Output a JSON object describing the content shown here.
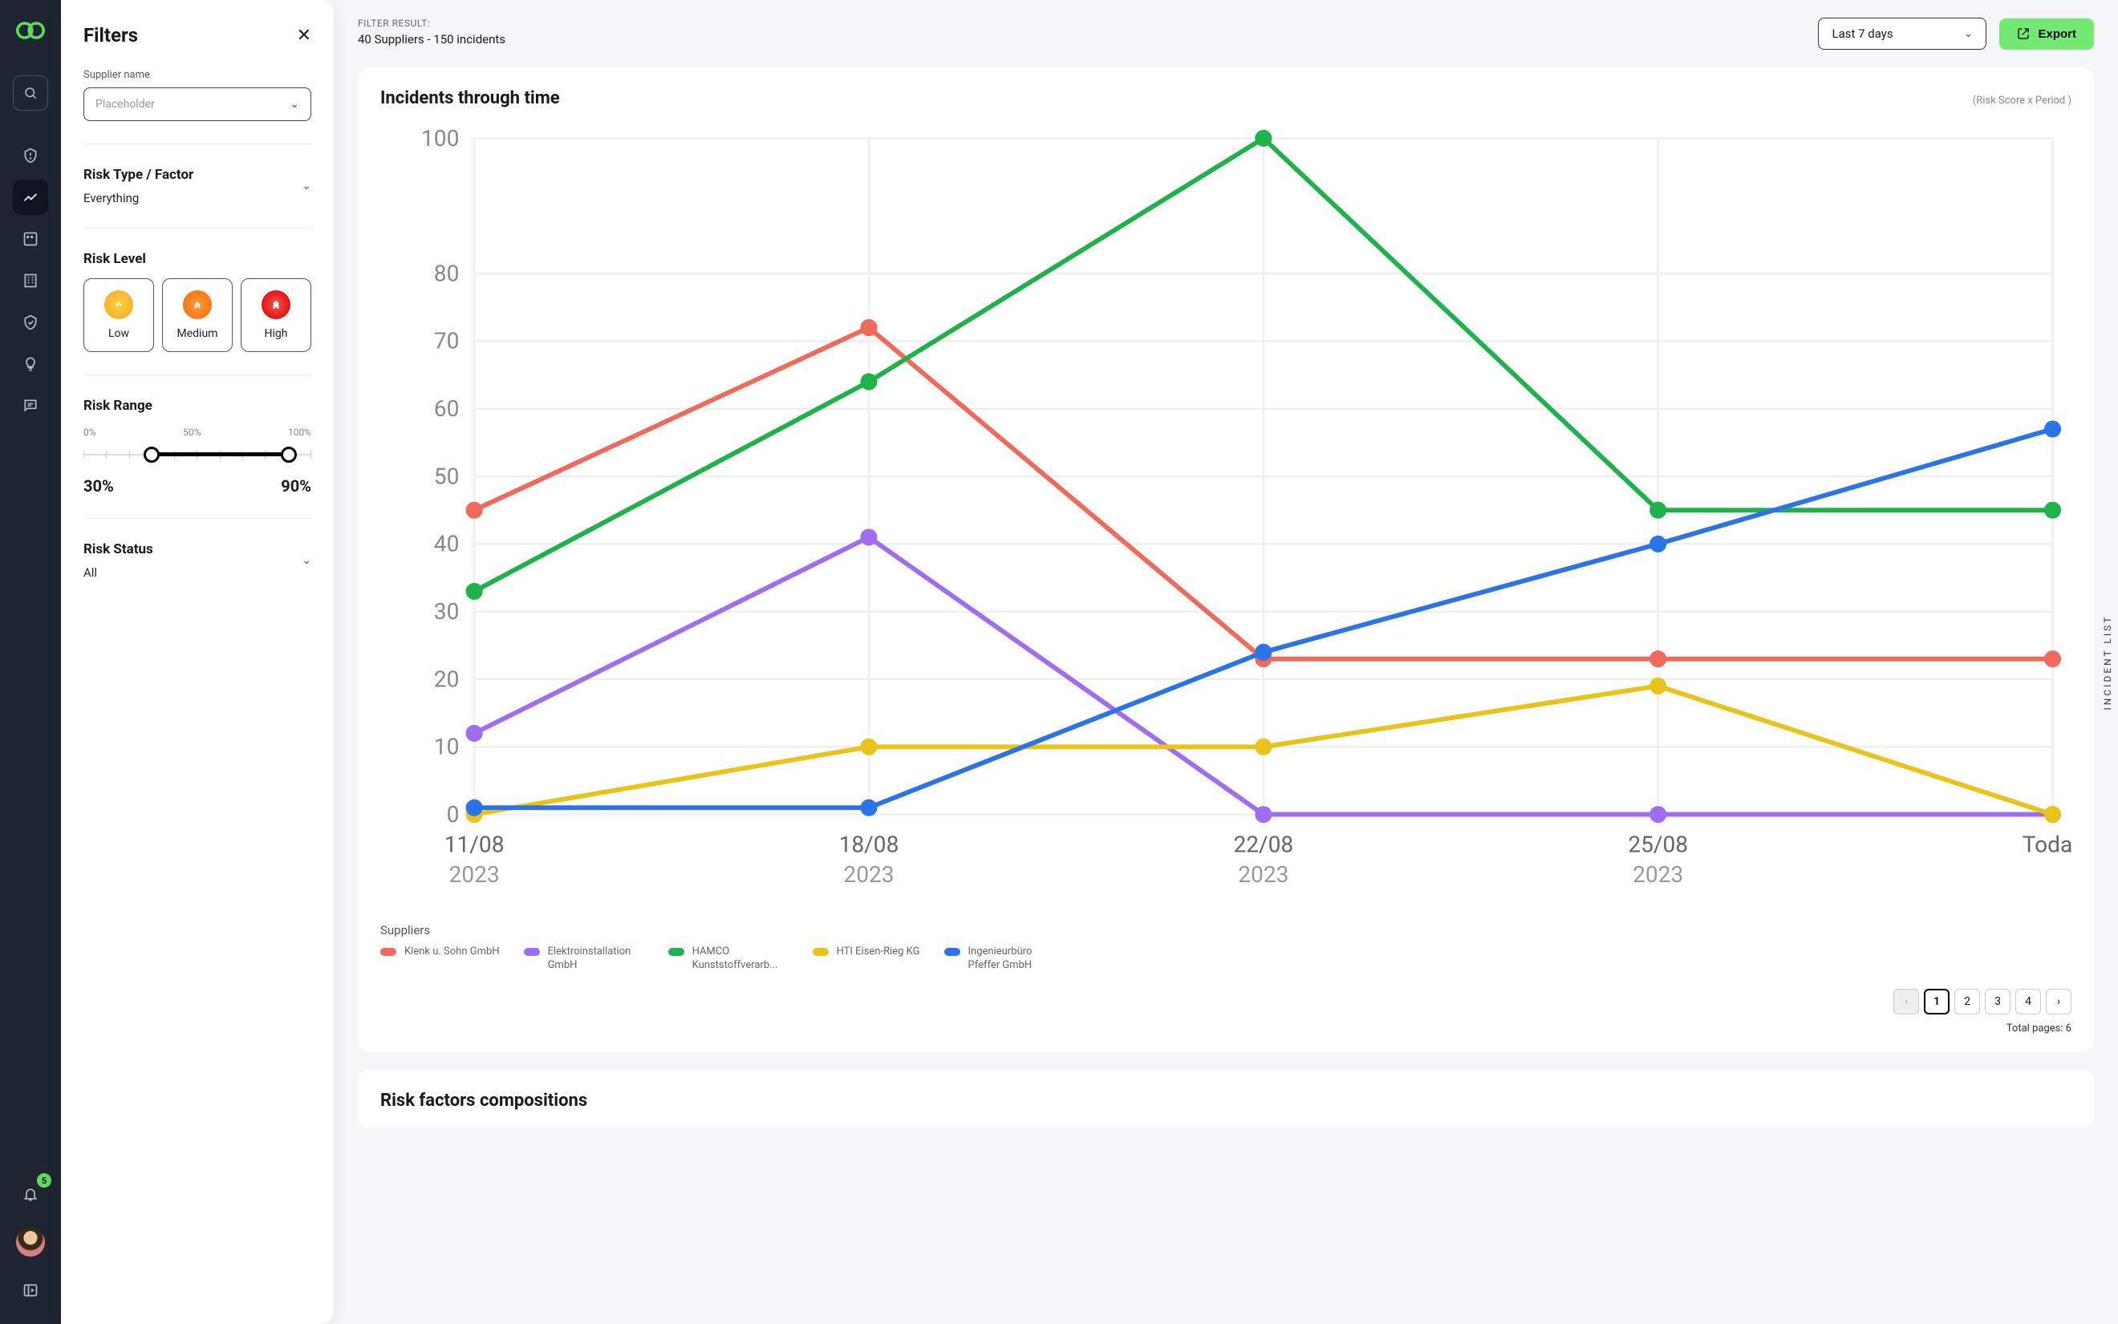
{
  "rail": {
    "notif_count": "5"
  },
  "filters": {
    "title": "Filters",
    "supplier_label": "Supplier name",
    "supplier_placeholder": "Placeholder",
    "risk_type_title": "Risk Type / Factor",
    "risk_type_value": "Everything",
    "risk_level_title": "Risk Level",
    "levels": {
      "low": "Low",
      "med": "Medium",
      "high": "High"
    },
    "risk_range_title": "Risk Range",
    "range_scale": {
      "min": "0%",
      "mid": "50%",
      "max": "100%"
    },
    "range_vals": {
      "low": "30%",
      "high": "90%"
    },
    "risk_status_title": "Risk Status",
    "risk_status_value": "All"
  },
  "topbar": {
    "filter_result_label": "FILTER RESULT:",
    "filter_result_text": "40 Suppliers - 150 incidents",
    "period": "Last 7 days",
    "export": "Export"
  },
  "chart_card": {
    "title": "Incidents through time",
    "note": "(Risk Score x Period )",
    "legend_title": "Suppliers",
    "legend": [
      {
        "color": "#ef6a5a",
        "label": "Klenk u. Sohn GmbH"
      },
      {
        "color": "#a06cf0",
        "label": "Elektroinstallation GmbH"
      },
      {
        "color": "#1fb24a",
        "label": "HAMCO Kunststoffverarb..."
      },
      {
        "color": "#e9c319",
        "label": "HTI Eisen-Rieg KG"
      },
      {
        "color": "#2b73e8",
        "label": "Ingenieurbüro Pfeffer GmbH"
      }
    ],
    "pager": {
      "pages": [
        "1",
        "2",
        "3",
        "4"
      ],
      "active": "1",
      "total_pages_text": "Total pages: 6"
    }
  },
  "chart_data": {
    "type": "line",
    "xlabel": "",
    "ylabel": "",
    "ylim": [
      0,
      100
    ],
    "title": "Incidents through time",
    "categories": [
      "11/08",
      "18/08",
      "22/08",
      "25/08",
      "Today"
    ],
    "categories_sub": [
      "2023",
      "2023",
      "2023",
      "2023",
      ""
    ],
    "yticks": [
      0,
      10,
      20,
      30,
      40,
      50,
      60,
      70,
      80,
      100
    ],
    "series": [
      {
        "name": "Klenk u. Sohn GmbH",
        "color": "#ef6a5a",
        "values": [
          45,
          72,
          23,
          23,
          23
        ]
      },
      {
        "name": "Elektroinstallation GmbH",
        "color": "#a06cf0",
        "values": [
          12,
          41,
          0,
          0,
          0
        ]
      },
      {
        "name": "HAMCO Kunststoffverarb...",
        "color": "#1fb24a",
        "values": [
          33,
          64,
          100,
          45,
          45
        ]
      },
      {
        "name": "HTI Eisen-Rieg KG",
        "color": "#e9c319",
        "values": [
          0,
          10,
          10,
          19,
          0
        ]
      },
      {
        "name": "Ingenieurbüro Pfeffer GmbH",
        "color": "#2b73e8",
        "values": [
          1,
          1,
          24,
          40,
          57
        ]
      }
    ]
  },
  "second_card": {
    "title": "Risk factors compositions"
  },
  "side_tab": "INCIDENT LIST"
}
